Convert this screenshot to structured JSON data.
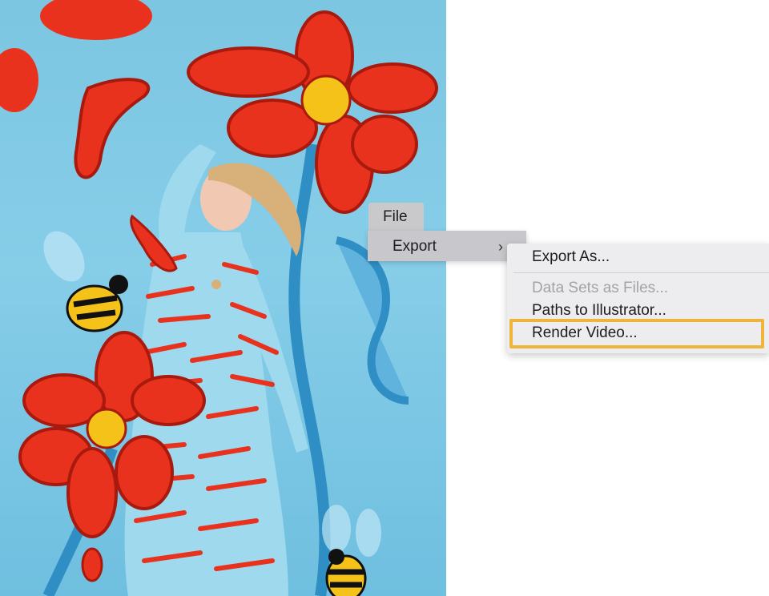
{
  "menubar": {
    "file_label": "File"
  },
  "file_menu": {
    "export_label": "Export",
    "export_chevron": "›"
  },
  "export_submenu": {
    "items": [
      {
        "label": "Export As...",
        "enabled": true
      },
      {
        "label": "Data Sets as Files...",
        "enabled": false
      },
      {
        "label": "Paths to Illustrator...",
        "enabled": true
      },
      {
        "label": "Render Video...",
        "enabled": true,
        "highlighted": true
      }
    ]
  },
  "colors": {
    "highlight_outline": "#efb53a",
    "menu_background": "#ededef",
    "menu_selected": "#c8c8cc",
    "canvas_sky": "#7cc6e2",
    "flower_red": "#e8321e",
    "flower_center": "#f5c21a"
  },
  "canvas": {
    "description_icon": "artwork-image"
  }
}
